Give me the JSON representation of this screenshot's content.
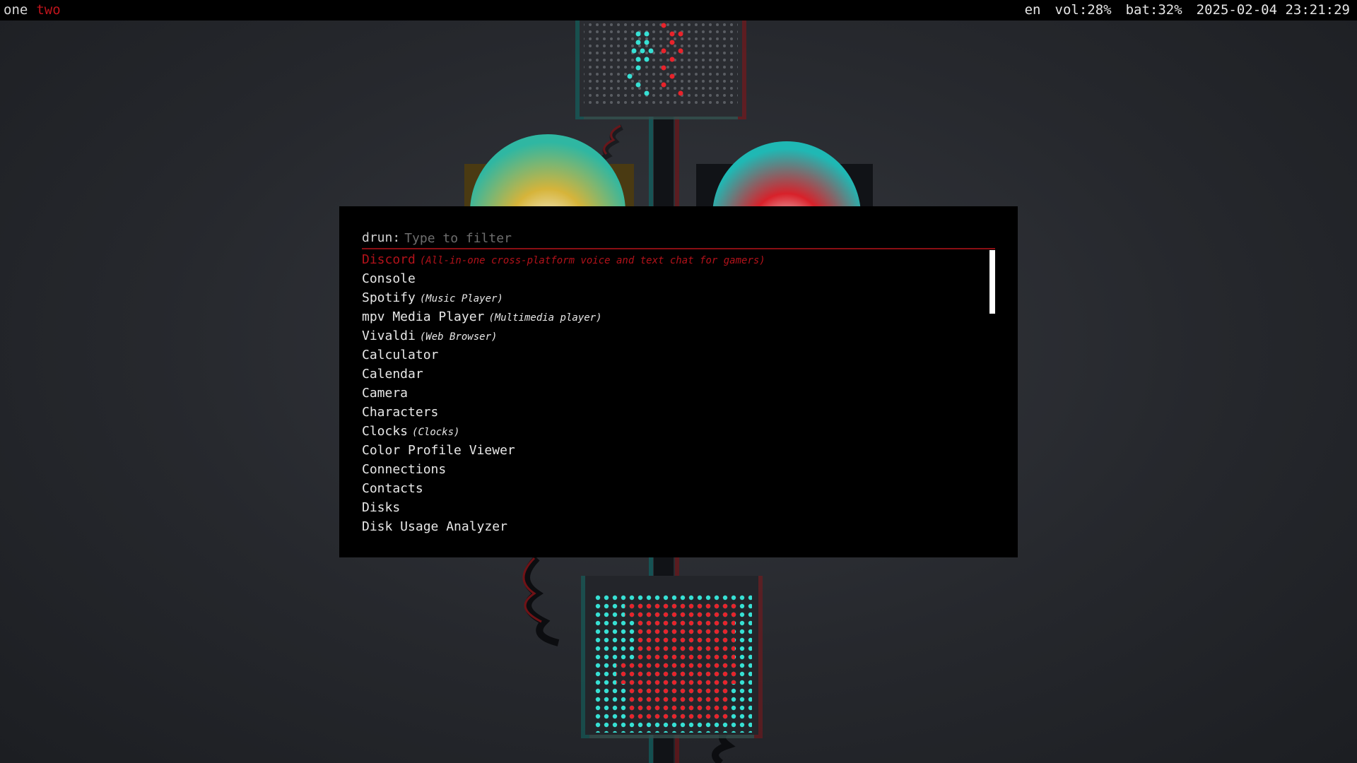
{
  "colors": {
    "bar_background": "#000000",
    "accent_red": "#c0141c",
    "text": "#e6e6e6",
    "launcher_background": "#000000"
  },
  "topbar": {
    "workspaces": [
      {
        "label": "one",
        "state": "active"
      },
      {
        "label": "two",
        "state": "inactive"
      }
    ],
    "status": {
      "keyboard_layout": "en",
      "volume": "vol:28%",
      "battery": "bat:32%",
      "datetime": "2025-02-04 23:21:29"
    }
  },
  "launcher": {
    "mode_label": "drun:",
    "placeholder": "Type to filter",
    "value": "",
    "entries": [
      {
        "name": "Discord",
        "description": "(All-in-one cross-platform voice and text chat for gamers)",
        "selected": true
      },
      {
        "name": "Console",
        "description": "",
        "selected": false
      },
      {
        "name": "Spotify",
        "description": "(Music Player)",
        "selected": false
      },
      {
        "name": "mpv Media Player",
        "description": "(Multimedia player)",
        "selected": false
      },
      {
        "name": "Vivaldi",
        "description": "(Web Browser)",
        "selected": false
      },
      {
        "name": "Calculator",
        "description": "",
        "selected": false
      },
      {
        "name": "Calendar",
        "description": "",
        "selected": false
      },
      {
        "name": "Camera",
        "description": "",
        "selected": false
      },
      {
        "name": "Characters",
        "description": "",
        "selected": false
      },
      {
        "name": "Clocks",
        "description": "(Clocks)",
        "selected": false
      },
      {
        "name": "Color Profile Viewer",
        "description": "",
        "selected": false
      },
      {
        "name": "Connections",
        "description": "",
        "selected": false
      },
      {
        "name": "Contacts",
        "description": "",
        "selected": false
      },
      {
        "name": "Disks",
        "description": "",
        "selected": false
      },
      {
        "name": "Disk Usage Analyzer",
        "description": "",
        "selected": false
      }
    ]
  }
}
